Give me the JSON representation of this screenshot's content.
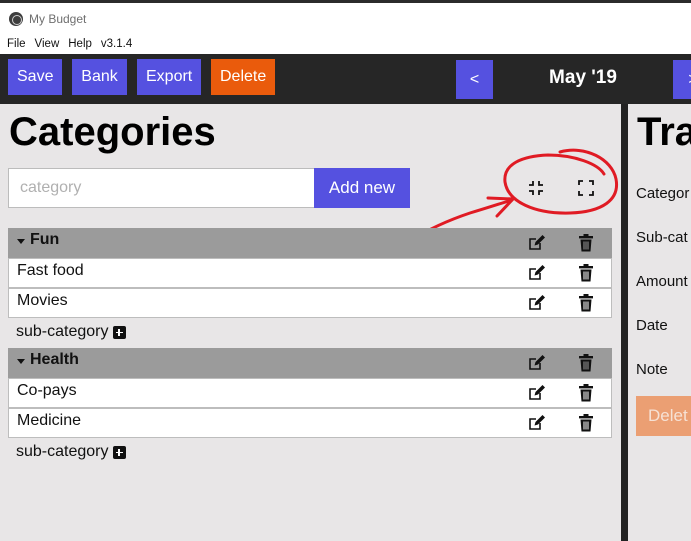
{
  "window": {
    "title": "My Budget"
  },
  "menu": {
    "file": "File",
    "view": "View",
    "help": "Help",
    "version": "v3.1.4"
  },
  "toolbar": {
    "save": "Save",
    "bank": "Bank",
    "export": "Export",
    "delete": "Delete",
    "prev": "<",
    "month": "May '19",
    "next": ">"
  },
  "categories": {
    "title": "Categories",
    "input_placeholder": "category",
    "add_label": "Add new",
    "groups": [
      {
        "name": "Fun",
        "items": [
          "Fast food",
          "Movies"
        ],
        "add_sub": "sub-category"
      },
      {
        "name": "Health",
        "items": [
          "Co-pays",
          "Medicine"
        ],
        "add_sub": "sub-category"
      }
    ]
  },
  "transaction": {
    "title": "Tra",
    "labels": [
      "Categor",
      "Sub-cat",
      "Amount",
      "Date",
      "Note"
    ],
    "delete_label": "Delet"
  },
  "colors": {
    "accent": "#5551e0",
    "danger": "#ea5b0c",
    "toolbar": "#262626",
    "group_header": "#9b9b9b",
    "annotation": "#e01b24"
  },
  "icons": [
    "collapse-icon",
    "expand-icon",
    "caret-down-icon",
    "edit-icon",
    "trash-icon",
    "plus-square-icon"
  ]
}
